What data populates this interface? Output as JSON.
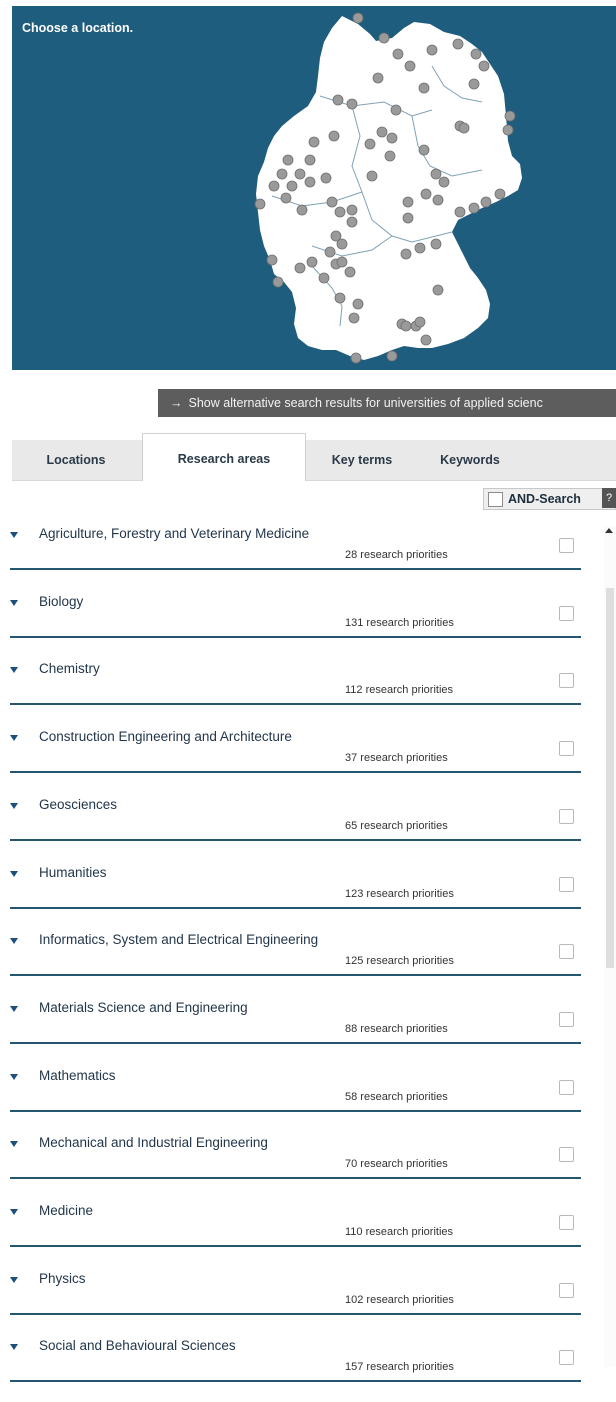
{
  "map": {
    "title": "Choose a location.",
    "colors": {
      "background": "#1f5d7e",
      "land": "#ffffff",
      "marker": "#9a9a9a"
    }
  },
  "alt_link": {
    "icon": "arrow-right-icon",
    "label": "Show alternative search results for universities of applied scienc"
  },
  "tabs": [
    {
      "label": "Locations",
      "active": false
    },
    {
      "label": "Research areas",
      "active": true
    },
    {
      "label": "Key terms",
      "active": false
    },
    {
      "label": "Keywords",
      "active": false
    }
  ],
  "and_search": {
    "label": "AND-Search",
    "help": "?"
  },
  "areas": [
    {
      "name": "Agriculture, Forestry and Veterinary Medicine",
      "count": "28 research priorities"
    },
    {
      "name": "Biology",
      "count": "131 research priorities"
    },
    {
      "name": "Chemistry",
      "count": "112 research priorities"
    },
    {
      "name": "Construction Engineering and Architecture",
      "count": "37 research priorities"
    },
    {
      "name": "Geosciences",
      "count": "65 research priorities"
    },
    {
      "name": "Humanities",
      "count": "123 research priorities"
    },
    {
      "name": "Informatics, System and Electrical Engineering",
      "count": "125 research priorities"
    },
    {
      "name": "Materials Science and Engineering",
      "count": "88 research priorities"
    },
    {
      "name": "Mathematics",
      "count": "58 research priorities"
    },
    {
      "name": "Mechanical and Industrial Engineering",
      "count": "70 research priorities"
    },
    {
      "name": "Medicine",
      "count": "110 research priorities"
    },
    {
      "name": "Physics",
      "count": "102 research priorities"
    },
    {
      "name": "Social and Behavioural Sciences",
      "count": "157 research priorities"
    }
  ]
}
